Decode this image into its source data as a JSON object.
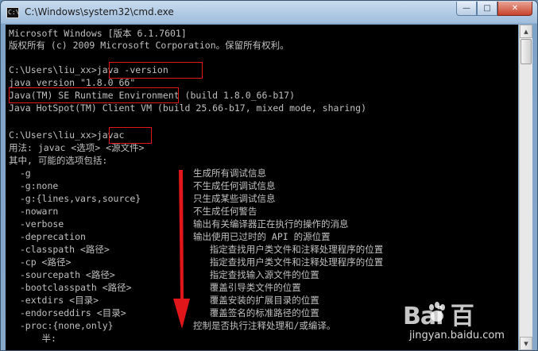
{
  "window": {
    "title": "C:\\Windows\\system32\\cmd.exe",
    "app_icon_text": "C:\\",
    "minimize_glyph": "—",
    "maximize_glyph": "□",
    "close_glyph": "✕"
  },
  "console": {
    "lines": [
      "Microsoft Windows [版本 6.1.7601]",
      "版权所有 (c) 2009 Microsoft Corporation。保留所有权利。",
      "",
      "C:\\Users\\liu_xx>java -version",
      "java version \"1.8.0_66\"",
      "Java(TM) SE Runtime Environment (build 1.8.0_66-b17)",
      "Java HotSpot(TM) Client VM (build 25.66-b17, mixed mode, sharing)",
      "",
      "C:\\Users\\liu_xx>javac",
      "用法: javac <选项> <源文件>",
      "其中, 可能的选项包括:"
    ],
    "options": [
      {
        "flag": "  -g",
        "desc": "生成所有调试信息"
      },
      {
        "flag": "  -g:none",
        "desc": "不生成任何调试信息"
      },
      {
        "flag": "  -g:{lines,vars,source}",
        "desc": "只生成某些调试信息"
      },
      {
        "flag": "  -nowarn",
        "desc": "不生成任何警告"
      },
      {
        "flag": "  -verbose",
        "desc": "输出有关编译器正在执行的操作的消息"
      },
      {
        "flag": "  -deprecation",
        "desc": "输出使用已过时的 API 的源位置"
      },
      {
        "flag": "  -classpath <路径>",
        "desc": "   指定查找用户类文件和注释处理程序的位置"
      },
      {
        "flag": "  -cp <路径>",
        "desc": "   指定查找用户类文件和注释处理程序的位置"
      },
      {
        "flag": "  -sourcepath <路径>",
        "desc": "   指定查找输入源文件的位置"
      },
      {
        "flag": "  -bootclasspath <路径>",
        "desc": "   覆盖引导类文件的位置"
      },
      {
        "flag": "  -extdirs <目录>",
        "desc": "   覆盖安装的扩展目录的位置"
      },
      {
        "flag": "  -endorseddirs <目录>",
        "desc": "   覆盖签名的标准路径的位置"
      },
      {
        "flag": "  -proc:{none,only}",
        "desc": "控制是否执行注释处理和/或编译。"
      },
      {
        "flag": "      半:",
        "desc": ""
      }
    ],
    "colors": {
      "text": "#c0c0c0",
      "background": "#000000",
      "highlight": "#e0161a"
    }
  },
  "watermark": {
    "logo": "Bai  百",
    "site": "jingyan.baidu.com"
  }
}
